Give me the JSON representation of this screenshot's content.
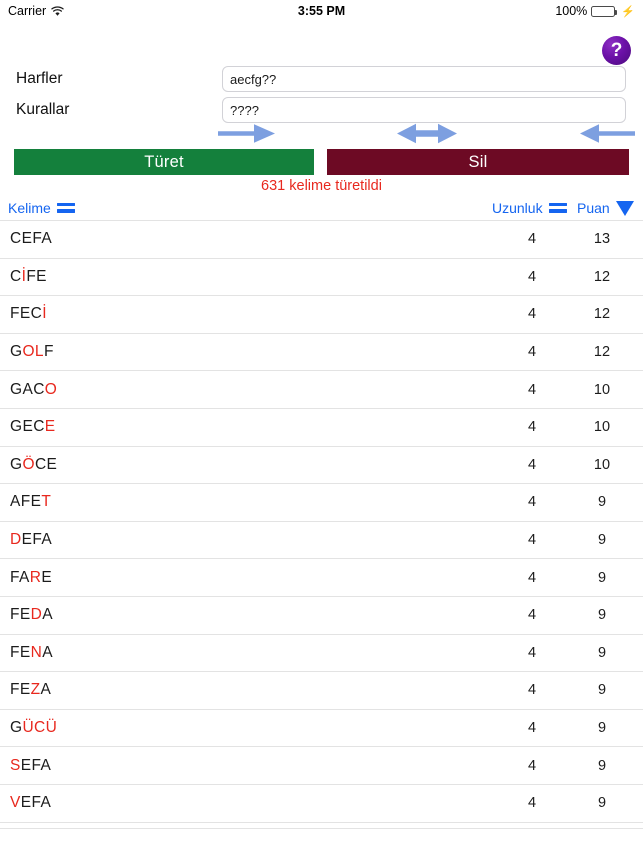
{
  "status_bar": {
    "carrier": "Carrier",
    "wifi_icon": "wifi-icon",
    "time": "3:55 PM",
    "battery_percent": "100%",
    "battery_icon": "battery-icon",
    "charging_icon": "lightning-bolt-icon",
    "battery_color": "#4cd964"
  },
  "help": {
    "label": "?",
    "icon": "question-mark-icon",
    "color": "#6c11a8"
  },
  "form": {
    "letters": {
      "label": "Harfler",
      "value": "aecfg??"
    },
    "rules": {
      "label": "Kurallar",
      "value": "????"
    }
  },
  "arrows": {
    "right": "arrow-right-icon",
    "both": "arrow-left-right-icon",
    "left": "arrow-left-icon",
    "color": "#7d9fe0"
  },
  "actions": {
    "generate_label": "Türet",
    "generate_color": "#14803c",
    "delete_label": "Sil",
    "delete_color": "#6d0a24"
  },
  "counter": {
    "text": "631 kelime türetildi",
    "count": 631,
    "color": "#e8281e"
  },
  "table": {
    "headers": {
      "word": "Kelime",
      "word_sort_icon": "equals-icon",
      "length": "Uzunluk",
      "length_sort_icon": "equals-icon",
      "score": "Puan",
      "score_sort_icon": "triangle-down-icon"
    },
    "header_color": "#1565f0",
    "highlight_color": "#e8281e",
    "rows": [
      {
        "segments": [
          {
            "t": "CEFA",
            "h": false
          }
        ],
        "word": "CEFA",
        "length": "4",
        "score": "13"
      },
      {
        "segments": [
          {
            "t": "C",
            "h": false
          },
          {
            "t": "İ",
            "h": true
          },
          {
            "t": "FE",
            "h": false
          }
        ],
        "word": "CİFE",
        "length": "4",
        "score": "12"
      },
      {
        "segments": [
          {
            "t": "FEC",
            "h": false
          },
          {
            "t": "İ",
            "h": true
          }
        ],
        "word": "FECİ",
        "length": "4",
        "score": "12"
      },
      {
        "segments": [
          {
            "t": "G",
            "h": false
          },
          {
            "t": "OL",
            "h": true
          },
          {
            "t": "F",
            "h": false
          }
        ],
        "word": "GOLF",
        "length": "4",
        "score": "12"
      },
      {
        "segments": [
          {
            "t": "GAC",
            "h": false
          },
          {
            "t": "O",
            "h": true
          }
        ],
        "word": "GACO",
        "length": "4",
        "score": "10"
      },
      {
        "segments": [
          {
            "t": "GEC",
            "h": false
          },
          {
            "t": "E",
            "h": true
          }
        ],
        "word": "GECE",
        "length": "4",
        "score": "10"
      },
      {
        "segments": [
          {
            "t": "G",
            "h": false
          },
          {
            "t": "Ö",
            "h": true
          },
          {
            "t": "CE",
            "h": false
          }
        ],
        "word": "GÖCE",
        "length": "4",
        "score": "10"
      },
      {
        "segments": [
          {
            "t": "AFE",
            "h": false
          },
          {
            "t": "T",
            "h": true
          }
        ],
        "word": "AFET",
        "length": "4",
        "score": "9"
      },
      {
        "segments": [
          {
            "t": "D",
            "h": true
          },
          {
            "t": "EFA",
            "h": false
          }
        ],
        "word": "DEFA",
        "length": "4",
        "score": "9"
      },
      {
        "segments": [
          {
            "t": "FA",
            "h": false
          },
          {
            "t": "R",
            "h": true
          },
          {
            "t": "E",
            "h": false
          }
        ],
        "word": "FARE",
        "length": "4",
        "score": "9"
      },
      {
        "segments": [
          {
            "t": "FE",
            "h": false
          },
          {
            "t": "D",
            "h": true
          },
          {
            "t": "A",
            "h": false
          }
        ],
        "word": "FEDA",
        "length": "4",
        "score": "9"
      },
      {
        "segments": [
          {
            "t": "FE",
            "h": false
          },
          {
            "t": "N",
            "h": true
          },
          {
            "t": "A",
            "h": false
          }
        ],
        "word": "FENA",
        "length": "4",
        "score": "9"
      },
      {
        "segments": [
          {
            "t": "FE",
            "h": false
          },
          {
            "t": "Z",
            "h": true
          },
          {
            "t": "A",
            "h": false
          }
        ],
        "word": "FEZA",
        "length": "4",
        "score": "9"
      },
      {
        "segments": [
          {
            "t": "G",
            "h": false
          },
          {
            "t": "ÜCÜ",
            "h": true
          }
        ],
        "word": "GÜCÜ",
        "length": "4",
        "score": "9"
      },
      {
        "segments": [
          {
            "t": "S",
            "h": true
          },
          {
            "t": "EFA",
            "h": false
          }
        ],
        "word": "SEFA",
        "length": "4",
        "score": "9"
      },
      {
        "segments": [
          {
            "t": "V",
            "h": true
          },
          {
            "t": "EFA",
            "h": false
          }
        ],
        "word": "VEFA",
        "length": "4",
        "score": "9"
      }
    ]
  }
}
